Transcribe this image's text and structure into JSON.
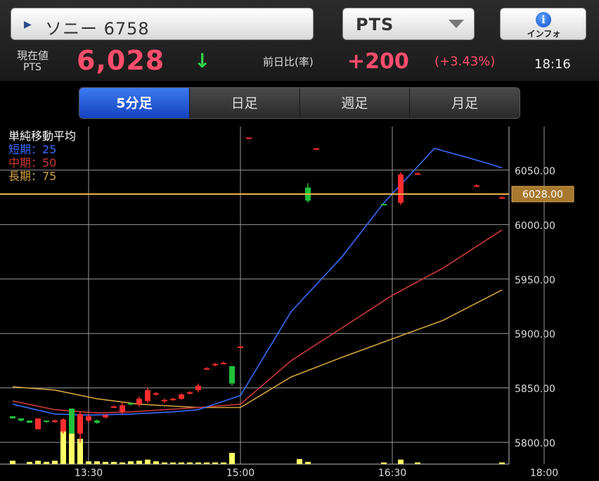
{
  "header": {
    "stock_label": "ソニー 6758",
    "stock_arrow": "▶",
    "market": "PTS",
    "info_label": "インフォ",
    "info_icon_glyph": "i"
  },
  "quote": {
    "price_label_line1": "現在値",
    "price_label_line2": "PTS",
    "price": "6,028",
    "price_arrow": "↓",
    "change_label": "前日比(率)",
    "change": "+200",
    "change_pct": "(+3.43%)",
    "time": "18:16"
  },
  "tabs": [
    {
      "label": "5分足",
      "active": true
    },
    {
      "label": "日足",
      "active": false
    },
    {
      "label": "週足",
      "active": false
    },
    {
      "label": "月足",
      "active": false
    }
  ],
  "legend": {
    "title": "単純移動平均",
    "short": "短期：25",
    "mid": "中期：50",
    "long": "長期：75"
  },
  "colors": {
    "up": "#ff2d2d",
    "down": "#1fc23a",
    "ma_short": "#3a6bff",
    "ma_mid": "#cc3a3a",
    "ma_long": "#d4a23c",
    "current_line": "#e8b04a",
    "volume": "#ffff66"
  },
  "chart_data": {
    "type": "candlestick",
    "ylim": [
      5780,
      6090
    ],
    "y_ticks": [
      "6050.00",
      "6000.00",
      "5950.00",
      "5900.00",
      "5850.00",
      "5800.00"
    ],
    "y_tick_values": [
      6050,
      6000,
      5950,
      5900,
      5850,
      5800
    ],
    "x_ticks": [
      "13:30",
      "15:00",
      "16:30",
      "18:00"
    ],
    "x_tick_positions": [
      9,
      27,
      45,
      63
    ],
    "current_price": 6028,
    "current_price_label": "6028.00",
    "candles": [
      [
        0,
        5824,
        5824,
        5822,
        5822
      ],
      [
        1,
        5822,
        5822,
        5819,
        5820
      ],
      [
        2,
        5820,
        5820,
        5818,
        5818
      ],
      [
        3,
        5812,
        5822,
        5812,
        5822
      ],
      [
        4,
        5820,
        5820,
        5818,
        5819
      ],
      [
        5,
        5819,
        5821,
        5818,
        5820
      ],
      [
        6,
        5810,
        5822,
        5808,
        5821
      ],
      [
        7,
        5831,
        5831,
        5808,
        5808
      ],
      [
        8,
        5808,
        5828,
        5800,
        5826
      ],
      [
        9,
        5820,
        5826,
        5818,
        5824
      ],
      [
        10,
        5820,
        5821,
        5817,
        5818
      ],
      [
        11,
        5823,
        5826,
        5822,
        5825
      ],
      [
        12,
        5833,
        5834,
        5832,
        5833
      ],
      [
        13,
        5828,
        5836,
        5826,
        5834
      ],
      [
        14,
        5836,
        5836,
        5834,
        5835
      ],
      [
        15,
        5835,
        5842,
        5833,
        5840
      ],
      [
        16,
        5838,
        5850,
        5836,
        5848
      ],
      [
        17,
        5845,
        5846,
        5843,
        5845
      ],
      [
        18,
        5838,
        5840,
        5836,
        5839
      ],
      [
        19,
        5839,
        5841,
        5838,
        5840
      ],
      [
        20,
        5840,
        5845,
        5839,
        5844
      ],
      [
        21,
        5845,
        5847,
        5844,
        5846
      ],
      [
        22,
        5848,
        5854,
        5846,
        5852
      ],
      [
        23,
        5868,
        5869,
        5867,
        5868
      ],
      [
        24,
        5871,
        5873,
        5870,
        5872
      ],
      [
        25,
        5873,
        5874,
        5872,
        5873
      ],
      [
        26,
        5870,
        5870,
        5852,
        5854
      ],
      [
        27,
        5888,
        5889,
        5887,
        5888
      ],
      [
        28,
        6080,
        6080,
        6080,
        6080
      ],
      [
        35,
        6034,
        6038,
        6020,
        6022
      ],
      [
        36,
        6070,
        6070,
        6070,
        6070
      ],
      [
        44,
        6019,
        6019,
        6018,
        6018
      ],
      [
        46,
        6020,
        6048,
        6018,
        6046
      ],
      [
        48,
        6047,
        6048,
        6046,
        6047
      ],
      [
        55,
        6036,
        6037,
        6035,
        6036
      ],
      [
        58,
        6025,
        6026,
        6024,
        6025
      ]
    ],
    "volume": [
      6,
      0,
      4,
      6,
      4,
      6,
      60,
      55,
      45,
      5,
      5,
      4,
      4,
      3,
      5,
      6,
      8,
      5,
      3,
      3,
      3,
      3,
      3,
      3,
      3,
      3,
      20,
      0,
      0,
      0,
      0,
      0,
      0,
      0,
      9,
      4,
      0,
      0,
      0,
      0,
      0,
      0,
      0,
      0,
      3,
      0,
      8,
      0,
      3,
      0,
      0,
      0,
      0,
      0,
      0,
      0,
      0,
      0,
      3
    ],
    "ma_short": [
      [
        0,
        5835
      ],
      [
        5,
        5826
      ],
      [
        9,
        5825
      ],
      [
        14,
        5826
      ],
      [
        19,
        5828
      ],
      [
        22,
        5830
      ],
      [
        27,
        5843
      ],
      [
        33,
        5920
      ],
      [
        39,
        5970
      ],
      [
        44,
        6020
      ],
      [
        47,
        6045
      ],
      [
        50,
        6070
      ],
      [
        56,
        6057
      ],
      [
        58,
        6052
      ]
    ],
    "ma_mid": [
      [
        0,
        5838
      ],
      [
        5,
        5830
      ],
      [
        10,
        5827
      ],
      [
        14,
        5828
      ],
      [
        22,
        5832
      ],
      [
        27,
        5835
      ],
      [
        33,
        5875
      ],
      [
        39,
        5905
      ],
      [
        45,
        5935
      ],
      [
        51,
        5960
      ],
      [
        58,
        5995
      ]
    ],
    "ma_long": [
      [
        0,
        5851
      ],
      [
        5,
        5848
      ],
      [
        10,
        5840
      ],
      [
        15,
        5835
      ],
      [
        22,
        5832
      ],
      [
        27,
        5832
      ],
      [
        33,
        5860
      ],
      [
        39,
        5878
      ],
      [
        45,
        5895
      ],
      [
        51,
        5912
      ],
      [
        58,
        5940
      ]
    ]
  }
}
